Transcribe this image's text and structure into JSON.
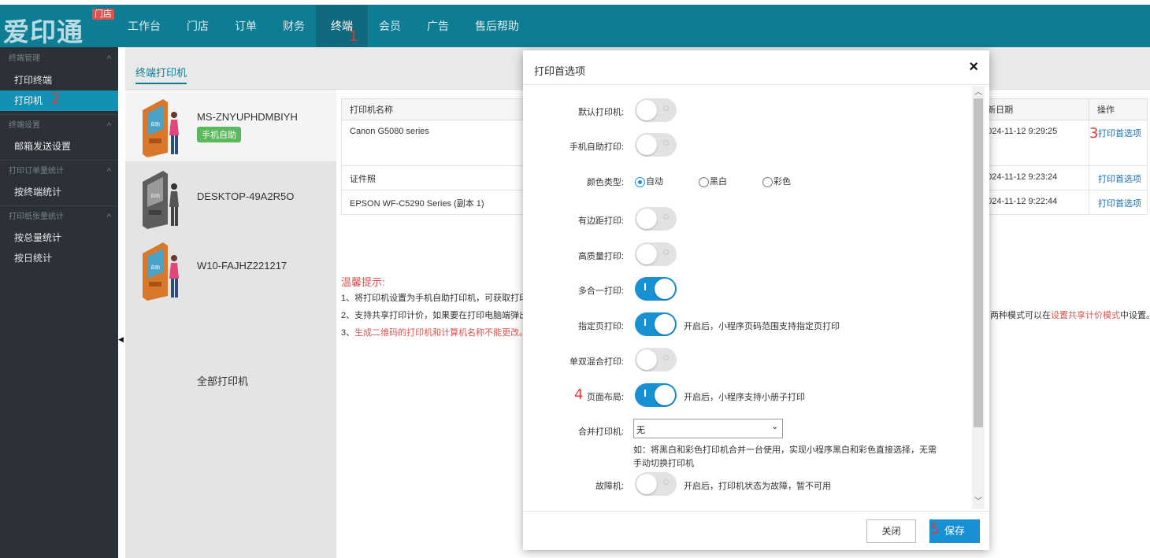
{
  "header": {
    "logo": "爱印通",
    "logo_badge": "门店",
    "nav": [
      "工作台",
      "门店",
      "订单",
      "财务",
      "终端",
      "会员",
      "广告",
      "售后帮助"
    ],
    "active_nav_index": 4
  },
  "sidebar": {
    "groups": [
      {
        "title": "终端管理",
        "items": [
          "打印终端",
          "打印机"
        ]
      },
      {
        "title": "终端设置",
        "items": [
          "邮箱发送设置"
        ]
      },
      {
        "title": "打印订单量统计",
        "items": [
          "按终端统计"
        ]
      },
      {
        "title": "打印纸张量统计",
        "items": [
          "按总量统计",
          "按日统计"
        ]
      }
    ],
    "active_item": "打印机"
  },
  "tab": "终端打印机",
  "devices": [
    {
      "name": "MS-ZNYUPHDMBIYH",
      "tag": "手机自助",
      "kiosk_color": "orange"
    },
    {
      "name": "DESKTOP-49A2R5O",
      "tag": "",
      "kiosk_color": "gray"
    },
    {
      "name": "W10-FAJHZ221217",
      "tag": "",
      "kiosk_color": "orange"
    }
  ],
  "all_printers_label": "全部打印机",
  "table": {
    "headers": {
      "name": "打印机名称",
      "date": "新日期",
      "op": "操作"
    },
    "rows": [
      {
        "name": "Canon G5080 series",
        "date": "024-11-12 9:29:25",
        "op": "打印首选项"
      },
      {
        "name": "证件照",
        "date": "024-11-12 9:23:24",
        "op": "打印首选项"
      },
      {
        "name": "EPSON WF-C5290 Series (副本 1)",
        "date": "024-11-12 9:22:44",
        "op": "打印首选项"
      }
    ]
  },
  "tips": {
    "title": "温馨提示:",
    "line1": "1、将打印机设置为手机自助打印机，可获取打印",
    "line2": "2、支持共享打印计价，如果要在打印电脑端弹出",
    "line3_prefix": "3、",
    "line3_red": "生成二维码的打印机和计算机名称不能更改。",
    "right_prefix": "两种模式可以在",
    "right_red": "设置共享计价模式",
    "right_suffix": "中设置。"
  },
  "annotations": [
    "1",
    "2",
    "3",
    "4",
    "5"
  ],
  "modal": {
    "title": "打印首选项",
    "close_icon": "×",
    "fields": {
      "default_printer": {
        "label": "默认打印机:",
        "on": false
      },
      "mobile_self": {
        "label": "手机自助打印:",
        "on": false
      },
      "color_type": {
        "label": "颜色类型:",
        "options": [
          "自动",
          "黑白",
          "彩色"
        ],
        "selected": "自动"
      },
      "margin_print": {
        "label": "有边距打印:",
        "on": false
      },
      "high_quality": {
        "label": "高质量打印:",
        "on": false
      },
      "multi_in_one": {
        "label": "多合一打印:",
        "on": true
      },
      "specified_pages": {
        "label": "指定页打印:",
        "on": true,
        "hint": "开启后，小程序页码范围支持指定页打印"
      },
      "duplex_mix": {
        "label": "单双混合打印:",
        "on": false
      },
      "page_layout": {
        "label": "页面布局:",
        "on": true,
        "hint": "开启后，小程序支持小册子打印"
      },
      "merge_printer": {
        "label": "合并打印机:",
        "value": "无",
        "note": "如：将黑白和彩色打印机合并一台使用，实现小程序黑白和彩色直接选择，无需手动切换打印机"
      },
      "fault": {
        "label": "故障机:",
        "on": false,
        "hint": "开启后，打印机状态为故障，暂不可用"
      }
    },
    "buttons": {
      "close": "关闭",
      "save": "保存"
    }
  }
}
